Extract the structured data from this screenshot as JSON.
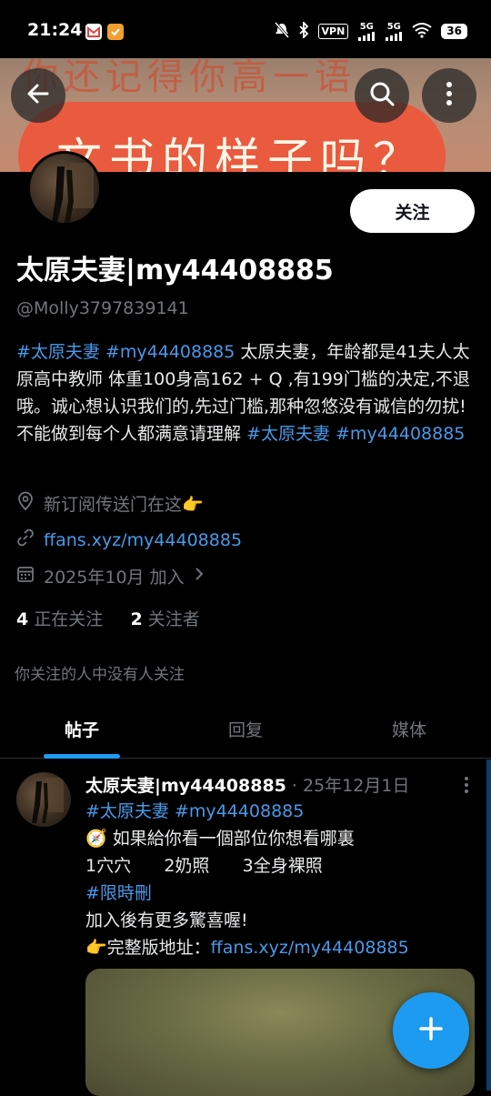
{
  "status_bar": {
    "time": "21:24",
    "vpn": "VPN",
    "signal1": "5G",
    "signal2": "5G",
    "battery": "36"
  },
  "banner": {
    "text_top": "你还记得你高一语",
    "text_main": "文书的样子吗？"
  },
  "profile": {
    "follow_label": "关注",
    "name": "太原夫妻|my44408885",
    "handle": "@Molly3797839141",
    "bio": {
      "tag1": "#太原夫妻",
      "tag2": "#my44408885",
      "text": " 太原夫妻，年龄都是41夫人太原高中教师 体重100身高162  + Q ,有199门槛的决定,不退哦。诚心想认识我们的,先过门槛,那种忽悠没有诚信的勿扰!不能做到每个人都满意请理解 ",
      "tag3": "#太原夫妻",
      "tag4": "#my44408885"
    },
    "location": "新订阅传送门在这👉",
    "website": "ffans.xyz/my44408885",
    "joined": "2025年10月 加入",
    "following_count": "4",
    "following_label": "正在关注",
    "followers_count": "2",
    "followers_label": "关注者",
    "no_common_followers": "你关注的人中没有人关注"
  },
  "tabs": [
    {
      "label": "帖子",
      "active": true
    },
    {
      "label": "回复",
      "active": false
    },
    {
      "label": "媒体",
      "active": false
    }
  ],
  "post": {
    "author": "太原夫妻|my44408885",
    "date": " · 25年12月1日",
    "tags": "#太原夫妻 #my44408885",
    "line1": "🧭 如果給你看一個部位你想看哪裏",
    "line2": "1穴穴      2奶照      3全身裸照",
    "line3": "#限時刪",
    "line4": "加入後有更多驚喜喔!",
    "line5_prefix": "👉完整版地址：",
    "line5_link": "ffans.xyz/my44408885"
  },
  "colors": {
    "accent": "#1d9bf0",
    "link": "#4a99e9",
    "muted": "#71767b",
    "background": "#000000"
  }
}
